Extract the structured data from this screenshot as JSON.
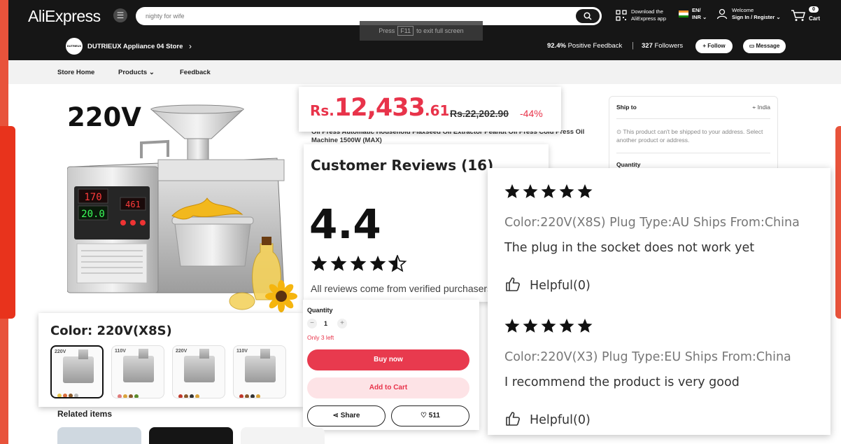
{
  "header": {
    "logo": "AliExpress",
    "search_placeholder": "nighty for wife",
    "fullscreen_hint_pre": "Press",
    "fullscreen_hint_key": "F11",
    "fullscreen_hint_post": "to exit full screen",
    "download_line1": "Download the",
    "download_line2": "AliExpress app",
    "lang_line1": "EN/",
    "lang_line2": "INR",
    "welcome": "Welcome",
    "signin": "Sign In / Register",
    "cart_count": "0",
    "cart_label": "Cart"
  },
  "store": {
    "logo_text": "DUTRIEUX",
    "name": "DUTRIEUX Appliance 04 Store",
    "positive_pct": "92.4%",
    "positive_label": "Positive Feedback",
    "separator": "|",
    "followers_count": "327",
    "followers_label": "Followers",
    "follow_label": "+ Follow",
    "message_label": "Message"
  },
  "nav": {
    "items": [
      "Store Home",
      "Products",
      "Feedback"
    ]
  },
  "product": {
    "voltage_banner": "220V",
    "title_peek": "Oil Press Automatic Household Flaxseed Oil Extractor Peanut Oil Press Cold Press Oil Machine 1500W (MAX)",
    "display_temp": "170",
    "display_time": "20.0",
    "display_red": "461"
  },
  "price": {
    "currency": "Rs.",
    "main": "12,433",
    "fraction": ".61",
    "original": "Rs.22,202.90",
    "discount": "-44%"
  },
  "shipping": {
    "label": "Ship to",
    "destination": "India",
    "message": "⊙ This product can't be shipped to your address. Select another product or address.",
    "quantity_label": "Quantity"
  },
  "reviews_summary": {
    "title": "Customer Reviews (16)",
    "score": "4.4",
    "rating": 4.5,
    "note": "All reviews come from verified purchasers"
  },
  "color": {
    "label": "Color: 220V(X8S)",
    "options": [
      "220V",
      "110V",
      "220V",
      "110V"
    ]
  },
  "purchase": {
    "quantity_label": "Quantity",
    "minus": "−",
    "quantity": "1",
    "plus": "+",
    "stock": "Only 3 left",
    "buy_now": "Buy now",
    "add_to_cart": "Add to Cart",
    "share": "Share",
    "wishlist_count": "511"
  },
  "reviews": [
    {
      "stars": 5,
      "meta": "Color:220V(X8S) Plug Type:AU Ships From:China",
      "body": "The plug in the socket does not work yet",
      "helpful": "Helpful(0)"
    },
    {
      "stars": 5,
      "meta": "Color:220V(X3) Plug Type:EU Ships From:China",
      "body": "I recommend the product is very good",
      "helpful": "Helpful(0)"
    }
  ],
  "related": {
    "title": "Related items"
  }
}
